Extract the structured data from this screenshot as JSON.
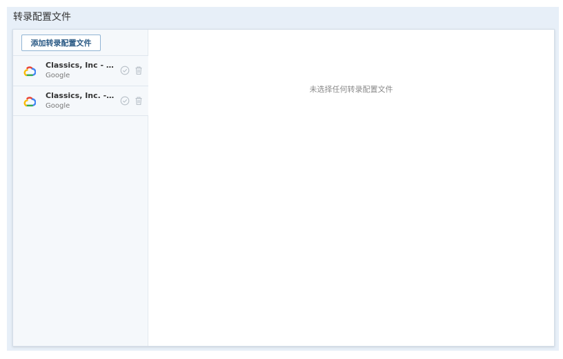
{
  "page": {
    "title": "转录配置文件"
  },
  "sidebar": {
    "add_button_label": "添加转录配置文件",
    "items": [
      {
        "title": "Classics, Inc - Spanish",
        "subtitle": "Google",
        "icon": "google-cloud-icon"
      },
      {
        "title": "Classics, Inc. - English",
        "subtitle": "Google",
        "icon": "google-cloud-icon"
      }
    ]
  },
  "main": {
    "empty_message": "未选择任何转录配置文件"
  },
  "colors": {
    "background": "#e7eff8",
    "panel": "#ffffff",
    "sidebar": "#f5f8fb",
    "button_text": "#2b5a85",
    "google_red": "#ea4335",
    "google_blue": "#4285f4",
    "google_yellow": "#fbbc05",
    "google_green": "#34a853"
  }
}
